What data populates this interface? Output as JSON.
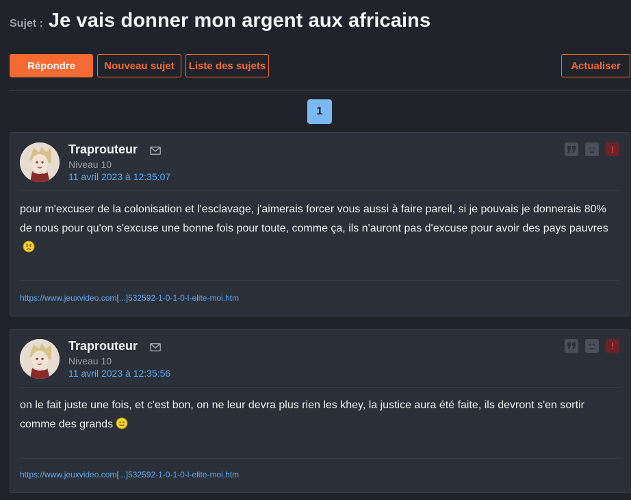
{
  "topic": {
    "prefix": "Sujet :",
    "title": "Je vais donner mon argent aux africains"
  },
  "toolbar": {
    "reply": "Répondre",
    "new_topic": "Nouveau sujet",
    "topic_list": "Liste des sujets",
    "refresh": "Actualiser"
  },
  "pagination": {
    "current": "1"
  },
  "colors": {
    "accent": "#f46a32",
    "link": "#5aaaf0",
    "page_active": "#7ab8f2"
  },
  "posts": [
    {
      "author": "Traprouteur",
      "level": "Niveau 10",
      "date": "11 avril 2023 à 12:35:07",
      "body": "pour m'excuser de la colonisation et l'esclavage, j'aimerais forcer vous aussi à faire pareil, si je pouvais je donnerais 80% de nous pour qu'on s'excuse une bonne fois pour toute, comme ça, ils n'auront pas d'excuse pour avoir des pays pauvres",
      "smiley": "worried-face-smiley",
      "signature_link": "https://www.jeuxvideo.com[...]532592-1-0-1-0-l-elite-moi.htm"
    },
    {
      "author": "Traprouteur",
      "level": "Niveau 10",
      "date": "11 avril 2023 à 12:35:56",
      "body": "on le fait juste une fois, et c'est bon, on ne leur devra plus rien les khey, la justice aura été faite, ils devront s'en sortir comme des grands",
      "smiley": "smiling-face-smiley",
      "signature_link": "https://www.jeuxvideo.com[...]532592-1-0-1-0-l-elite-moi.htm"
    }
  ],
  "icons": {
    "mail": "mail-icon",
    "quote": "quote-icon",
    "blacklist": "blacklist-icon",
    "report": "report-icon"
  }
}
